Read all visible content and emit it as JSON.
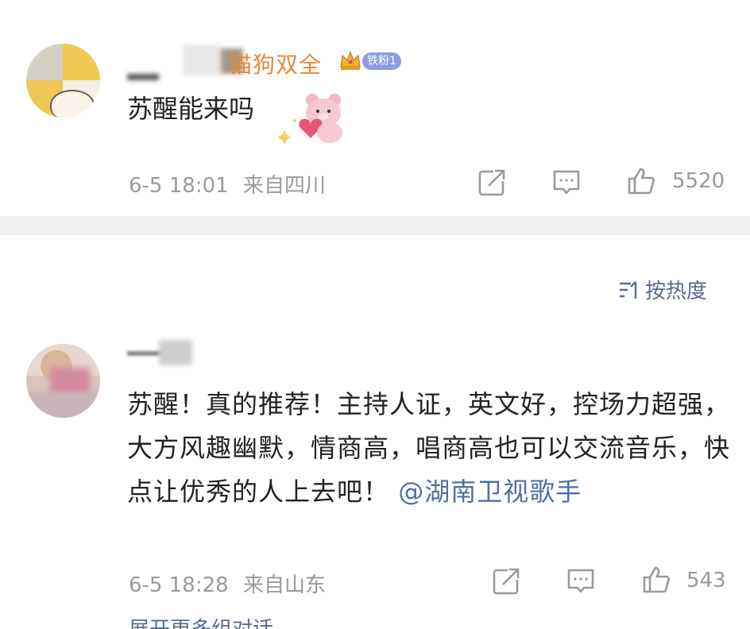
{
  "comments": [
    {
      "username_visible": "猫狗双全",
      "fan_badge": "铁粉1",
      "text": "苏醒能来吗",
      "timestamp": "6-5 18:01",
      "location": "来自四川",
      "likes": "5520"
    },
    {
      "text_main": "苏醒！真的推荐！主持人证，英文好，控场力超强，大方风趣幽默，情商高，唱商高也可以交流音乐，快点让优秀的人上去吧！",
      "mention": "@湖南卫视歌手",
      "timestamp": "6-5 18:28",
      "location": "来自山东",
      "likes": "543",
      "more_replies": "展开更多组对话"
    }
  ],
  "sort": {
    "label": "按热度",
    "icon": "sort-icon"
  },
  "colors": {
    "text": "#222222",
    "meta": "#9a9a9a",
    "link": "#4f6fa6",
    "username_orange": "#e4893a",
    "badge": "#8e9be3",
    "divider": "#efefef"
  },
  "icons": [
    "share-icon",
    "comment-icon",
    "like-icon",
    "crown-icon",
    "bear-sticker-icon"
  ]
}
